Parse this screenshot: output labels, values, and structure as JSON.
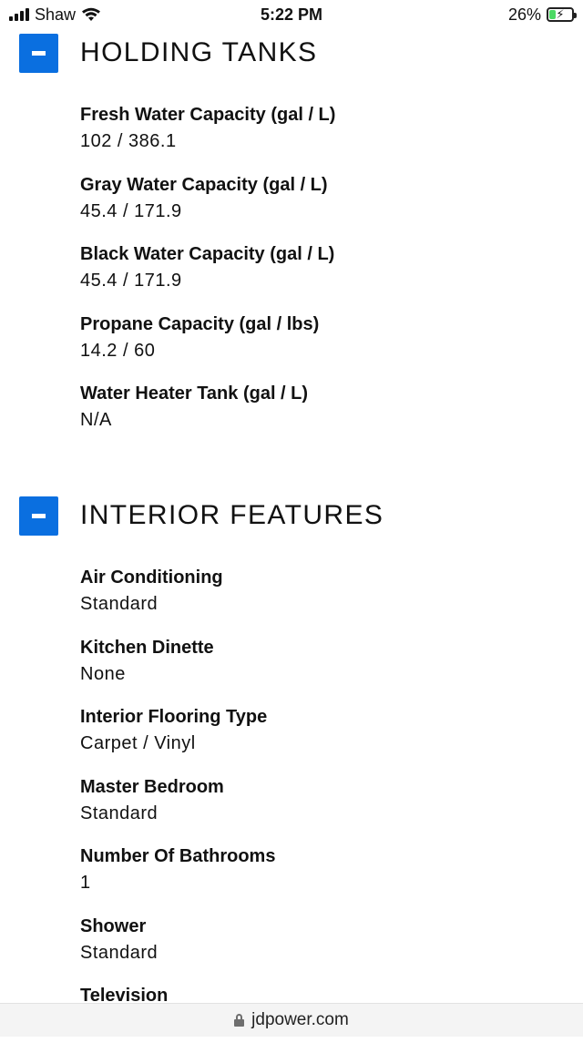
{
  "status_bar": {
    "carrier": "Shaw",
    "time": "5:22 PM",
    "battery": "26%",
    "battery_level": 0.26,
    "battery_color": "#4cd964"
  },
  "accent_color": "#0a6fe0",
  "sections": [
    {
      "title": "HOLDING TANKS",
      "toggle_icon": "minus-icon",
      "items": [
        {
          "label": "Fresh Water Capacity (gal / L)",
          "value": "102 / 386.1"
        },
        {
          "label": "Gray Water Capacity (gal / L)",
          "value": "45.4 / 171.9"
        },
        {
          "label": "Black Water Capacity (gal / L)",
          "value": "45.4 / 171.9"
        },
        {
          "label": "Propane Capacity (gal / lbs)",
          "value": "14.2 / 60"
        },
        {
          "label": "Water Heater Tank (gal / L)",
          "value": "N/A"
        }
      ]
    },
    {
      "title": "INTERIOR FEATURES",
      "toggle_icon": "minus-icon",
      "items": [
        {
          "label": "Air Conditioning",
          "value": "Standard"
        },
        {
          "label": "Kitchen Dinette",
          "value": "None"
        },
        {
          "label": "Interior Flooring Type",
          "value": "Carpet / Vinyl"
        },
        {
          "label": "Master Bedroom",
          "value": "Standard"
        },
        {
          "label": "Number Of Bathrooms",
          "value": "1"
        },
        {
          "label": "Shower",
          "value": "Standard"
        },
        {
          "label": "Television",
          "value": ""
        }
      ]
    }
  ],
  "url_bar": {
    "domain": "jdpower.com",
    "icon": "lock-icon"
  }
}
